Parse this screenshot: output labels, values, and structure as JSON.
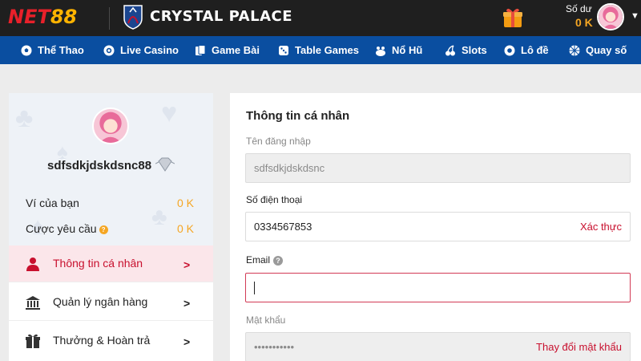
{
  "header": {
    "logo_text": "NET",
    "logo_num": "88",
    "partner_name": "CRYSTAL PALACE",
    "balance_label": "Số dư",
    "balance_value": "0 K"
  },
  "nav": [
    {
      "label": "Thể Thao",
      "icon": "soccer-ball-icon"
    },
    {
      "label": "Live Casino",
      "icon": "casino-chip-icon"
    },
    {
      "label": "Game Bài",
      "icon": "playing-cards-icon"
    },
    {
      "label": "Table Games",
      "icon": "dice-icon"
    },
    {
      "label": "Nổ Hũ",
      "icon": "jackpot-icon"
    },
    {
      "label": "Slots",
      "icon": "cherries-icon"
    },
    {
      "label": "Lô đề",
      "icon": "lottery-ball-icon"
    },
    {
      "label": "Quay số",
      "icon": "lucky-wheel-icon"
    }
  ],
  "sidebar": {
    "username": "sdfsdkjdskdsnc88",
    "wallet_label": "Ví của bạn",
    "wallet_value": "0 K",
    "bet_label": "Cược yêu cầu",
    "bet_value": "0 K",
    "menu": [
      {
        "label": "Thông tin cá nhân",
        "icon": "user-icon",
        "active": true
      },
      {
        "label": "Quản lý ngân hàng",
        "icon": "bank-icon",
        "active": false
      },
      {
        "label": "Thưởng & Hoàn trả",
        "icon": "gift-icon",
        "active": false
      }
    ]
  },
  "form": {
    "title": "Thông tin cá nhân",
    "username_label": "Tên đăng nhập",
    "username_value": "sdfsdkjdskdsnc",
    "phone_label": "Số điện thoại",
    "phone_value": "0334567853",
    "phone_action": "Xác thực",
    "email_label": "Email",
    "email_value": "",
    "password_label": "Mật khẩu",
    "password_value": "•••••••••••",
    "password_action": "Thay đổi mật khẩu"
  },
  "colors": {
    "topbar": "#1f1f1f",
    "navbar": "#0a4ea0",
    "brand_red": "#c8102e",
    "accent_orange": "#f5a623"
  }
}
